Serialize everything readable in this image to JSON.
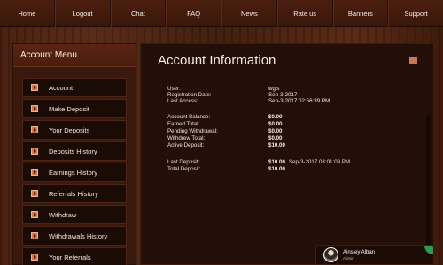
{
  "nav": {
    "items": [
      "Home",
      "Logout",
      "Chat",
      "FAQ",
      "News",
      "Rate us",
      "Banners",
      "Support"
    ]
  },
  "sidebar": {
    "title": "Account Menu",
    "items": [
      {
        "label": "Account"
      },
      {
        "label": "Make Deposit"
      },
      {
        "label": "Your Deposits"
      },
      {
        "label": "Deposits History"
      },
      {
        "label": "Earnings History"
      },
      {
        "label": "Referrals History"
      },
      {
        "label": "Withdraw"
      },
      {
        "label": "Withdrawals History"
      },
      {
        "label": "Your Referrals"
      }
    ]
  },
  "main": {
    "title": "Account Information",
    "user": {
      "label": "User:",
      "value": "wgls"
    },
    "registration_date": {
      "label": "Registration Date:",
      "value": "Sep-3-2017"
    },
    "last_access": {
      "label": "Last Access:",
      "value": "Sep-3-2017 02:56:39 PM"
    },
    "account_balance": {
      "label": "Account Balance:",
      "value": "$0.00"
    },
    "earned_total": {
      "label": "Earned Total:",
      "value": "$0.00"
    },
    "pending_withdrawal": {
      "label": "Pending Withdrawal:",
      "value": "$0.00"
    },
    "withdrew_total": {
      "label": "Withdrew Total:",
      "value": "$0.00"
    },
    "active_deposit": {
      "label": "Active Deposit:",
      "value": "$10.00"
    },
    "last_deposit": {
      "label": "Last Deposit:",
      "value": "$10.00",
      "date": "Sep-3-2017 03:01:09 PM"
    },
    "total_deposit": {
      "label": "Total Deposit:",
      "value": "$10.00"
    }
  },
  "chat": {
    "name": "Ainsley Alban",
    "role": "Admin"
  },
  "colors": {
    "accent": "#c77a57",
    "online": "#2d9a5a"
  }
}
